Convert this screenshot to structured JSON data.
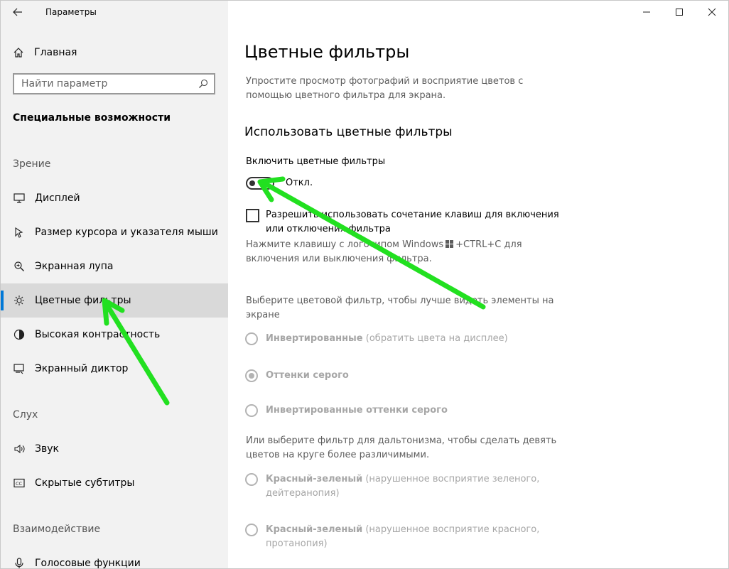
{
  "window": {
    "title": "Параметры",
    "controls": {
      "minimize_icon": "minimize-icon",
      "maximize_icon": "maximize-icon",
      "close_icon": "close-icon"
    }
  },
  "sidebar": {
    "home_label": "Главная",
    "search_placeholder": "Найти параметр",
    "section_title": "Специальные возможности",
    "groups": {
      "vision": "Зрение",
      "hearing": "Слух",
      "interaction": "Взаимодействие"
    },
    "items": [
      {
        "label": "Дисплей",
        "icon": "display-icon"
      },
      {
        "label": "Размер курсора и указателя мыши",
        "icon": "cursor-icon"
      },
      {
        "label": "Экранная лупа",
        "icon": "magnifier-icon"
      },
      {
        "label": "Цветные фильтры",
        "icon": "brightness-icon",
        "active": true
      },
      {
        "label": "Высокая контрастность",
        "icon": "contrast-icon"
      },
      {
        "label": "Экранный диктор",
        "icon": "narrator-icon"
      },
      {
        "label": "Звук",
        "icon": "speaker-icon"
      },
      {
        "label": "Скрытые субтитры",
        "icon": "captions-icon"
      },
      {
        "label": "Голосовые функции",
        "icon": "microphone-icon"
      }
    ]
  },
  "main": {
    "title": "Цветные фильтры",
    "description": "Упростите просмотр фотографий и восприятие цветов с помощью цветного фильтра для экрана.",
    "subtitle": "Использовать цветные фильтры",
    "toggle": {
      "label": "Включить цветные фильтры",
      "state": "Откл."
    },
    "shortcut_checkbox": {
      "label": "Разрешить использовать сочетание клавиш для включения или отключения фильтра",
      "checked": false
    },
    "hint": {
      "before": "Нажмите клавишу с логотипом Windows",
      "after": "+CTRL+C для включения или выключения фильтра."
    },
    "choose_text": "Выберите цветовой фильтр, чтобы лучше видеть элементы на экране",
    "filters": [
      {
        "name": "Инвертированные",
        "note": "(обратить цвета на дисплее)",
        "selected": false
      },
      {
        "name": "Оттенки серого",
        "note": "",
        "selected": true
      },
      {
        "name": "Инвертированные оттенки серого",
        "note": "",
        "selected": false
      }
    ],
    "colorblind_text": "Или выберите фильтр для дальтонизма, чтобы сделать девять цветов на круге более различимыми.",
    "colorblind_filters": [
      {
        "name": "Красный-зеленый",
        "note": "(нарушенное восприятие зеленого, дейтеранопия)",
        "selected": false
      },
      {
        "name": "Красный-зеленый",
        "note": "(нарушенное восприятие красного, протанопия)",
        "selected": false
      }
    ]
  },
  "colors": {
    "accent": "#0078d7",
    "annotation_arrow": "#22e020"
  }
}
